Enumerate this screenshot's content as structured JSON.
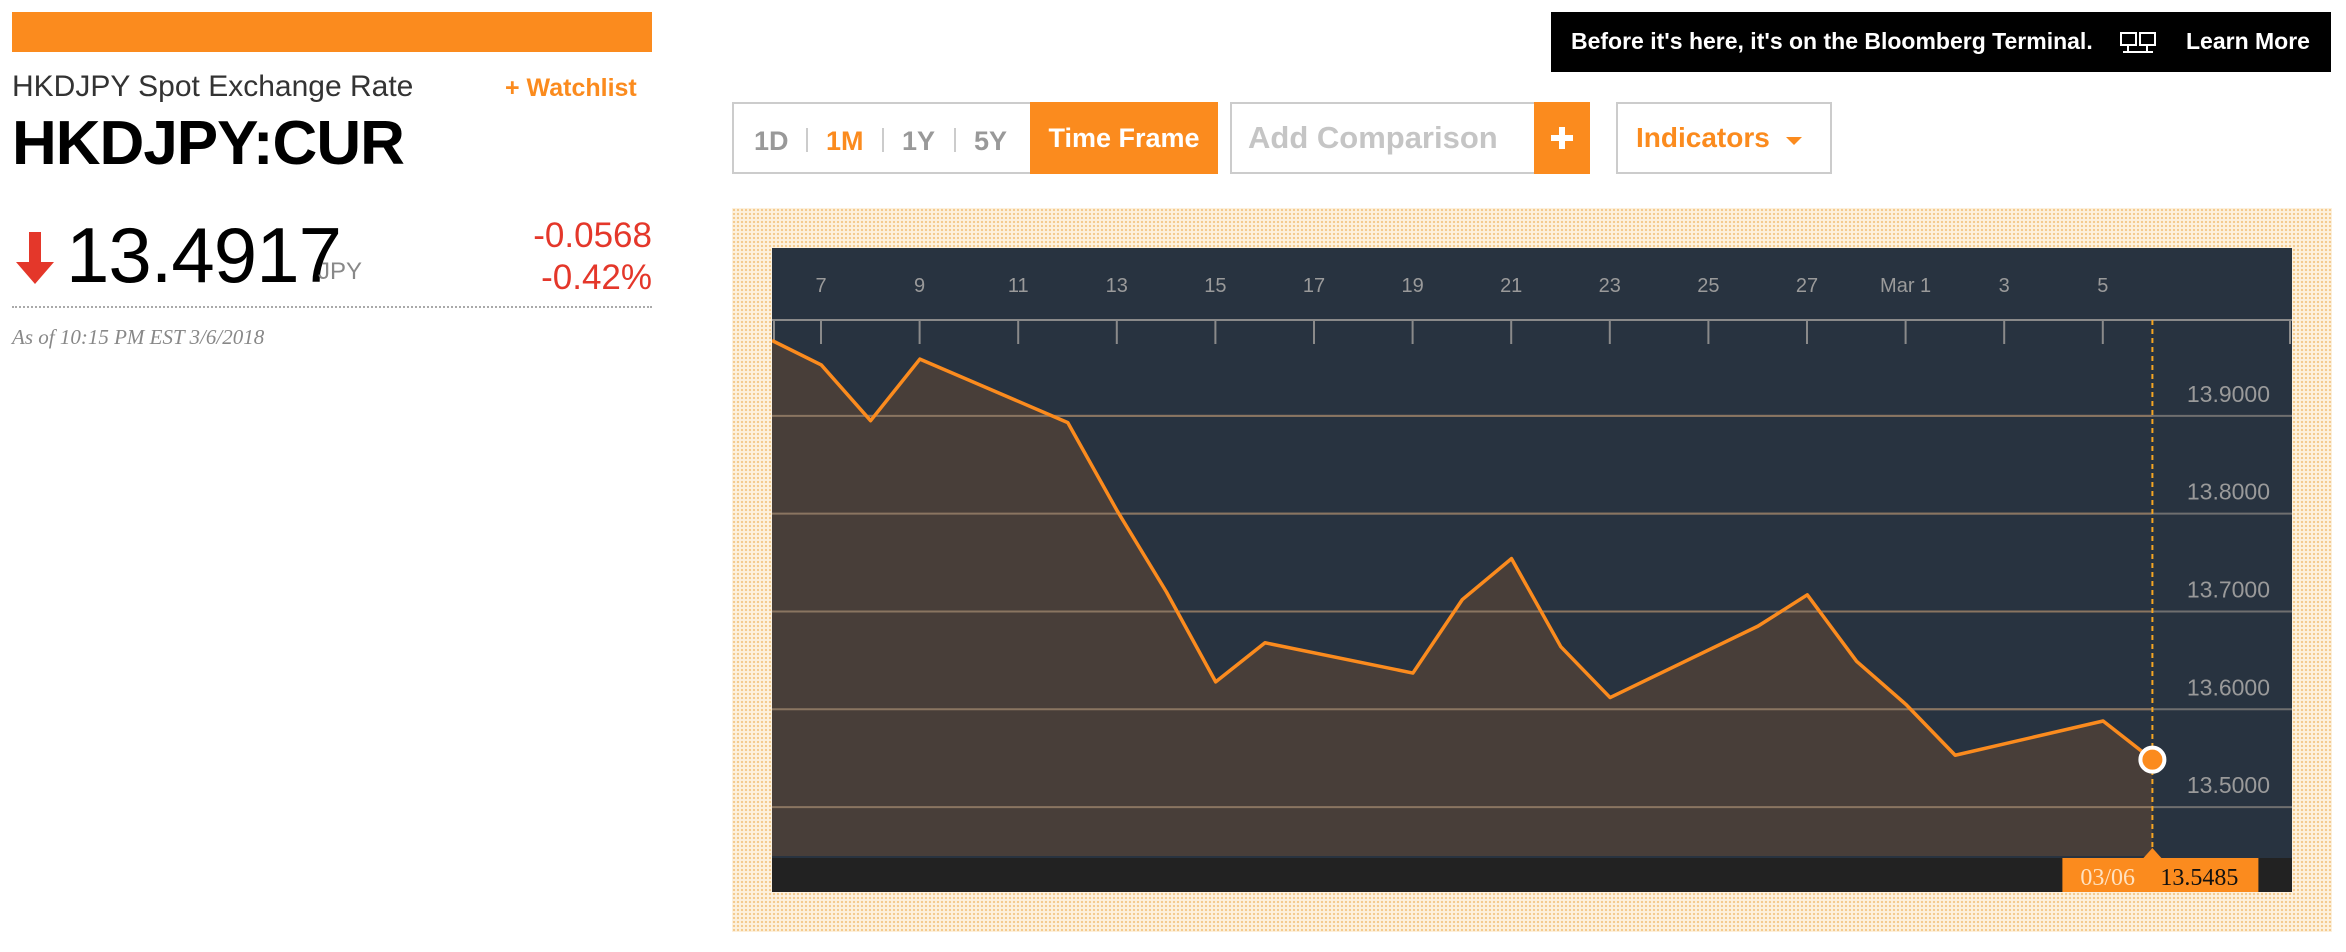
{
  "quote": {
    "name": "HKDJPY Spot Exchange Rate",
    "watchlist_label": "+ Watchlist",
    "ticker": "HKDJPY:CUR",
    "price": "13.4917",
    "currency": "JPY",
    "change": "-0.0568",
    "change_pct": "-0.42%",
    "as_of": "As of 10:15 PM EST 3/6/2018",
    "direction": "down",
    "down_color": "#e4372a",
    "accent": "#fb8b1e"
  },
  "banner": {
    "text": "Before it's here, it's on the Bloomberg Terminal.",
    "icon": "terminal-icon",
    "link": "Learn More"
  },
  "controls": {
    "ranges": [
      "1D",
      "1M",
      "1Y",
      "5Y"
    ],
    "active_range": "1M",
    "time_frame": "Time Frame",
    "comparison_placeholder": "Add Comparison",
    "add_icon": "plus-icon",
    "indicators": "Indicators"
  },
  "chart_data": {
    "type": "area",
    "x_ticks": [
      "7",
      "9",
      "11",
      "13",
      "15",
      "17",
      "19",
      "21",
      "23",
      "25",
      "27",
      "Mar 1",
      "3",
      "5"
    ],
    "x": [
      "2/6",
      "2/7",
      "2/8",
      "2/9",
      "2/12",
      "2/13",
      "2/14",
      "2/15",
      "2/16",
      "2/19",
      "2/20",
      "2/21",
      "2/22",
      "2/23",
      "2/26",
      "2/27",
      "2/28",
      "3/1",
      "3/2",
      "3/5",
      "3/6"
    ],
    "values": [
      13.977,
      13.952,
      13.895,
      13.958,
      13.893,
      13.803,
      13.72,
      13.628,
      13.668,
      13.637,
      13.712,
      13.754,
      13.664,
      13.612,
      13.685,
      13.717,
      13.649,
      13.605,
      13.553,
      13.588,
      13.5485
    ],
    "y_ticks": [
      "13.9000",
      "13.8000",
      "13.7000",
      "13.6000",
      "13.5000"
    ],
    "ylim": [
      13.45,
      14.0
    ],
    "grid": true,
    "tooltip": {
      "date": "03/06",
      "value": "13.5485"
    },
    "line_color": "#fb8b1e",
    "area_color": "#4a3f39",
    "background_color": "#283340"
  }
}
